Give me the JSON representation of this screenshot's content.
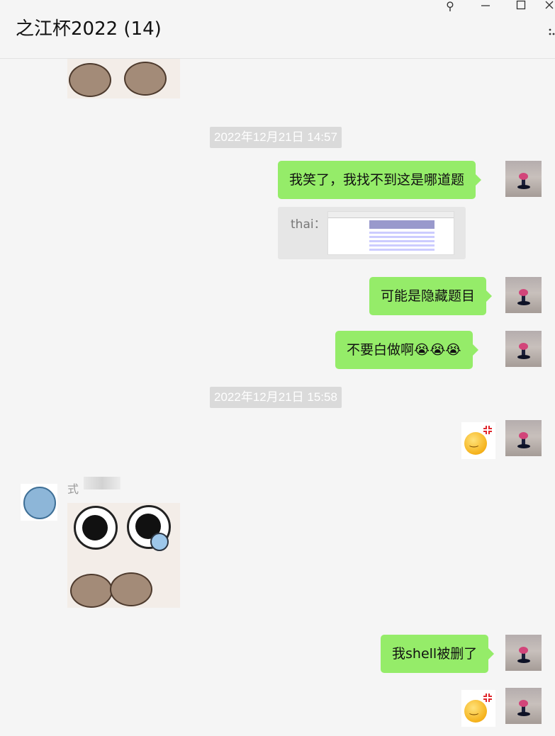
{
  "window": {
    "title": "之江杯2022 (14)",
    "controls": {
      "pin": "⚲",
      "minimize": "—",
      "maximize": "☐",
      "close": "✕",
      "more": "⋯"
    }
  },
  "messages": {
    "timestamp_1": "2022年12月21日 14:57",
    "msg_1": "我笑了，我找不到这是哪道题",
    "quote_label": "thai：",
    "msg_2": "可能是隐藏题目",
    "msg_3": "不要白做啊😭😭😭",
    "timestamp_2": "2022年12月21日 15:58",
    "sender_name": "式",
    "msg_4": "我shell被删了"
  },
  "colors": {
    "self_bubble": "#95ec69",
    "background": "#f5f5f5",
    "timestamp_bg": "#dadada"
  },
  "icons": {
    "pin": "pin-icon",
    "minimize": "minimize-icon",
    "maximize": "maximize-icon",
    "close": "close-icon",
    "more": "more-icon"
  }
}
